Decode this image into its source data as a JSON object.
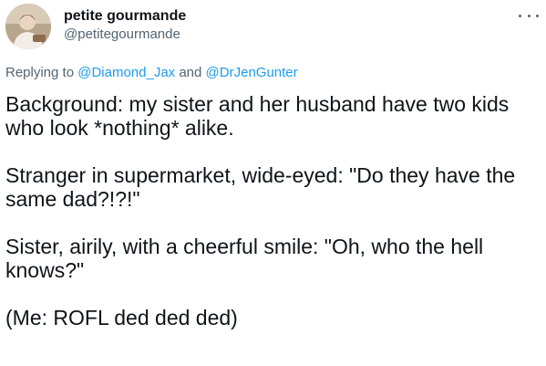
{
  "tweet": {
    "author": {
      "display_name": "petite gourmande",
      "handle": "@petitegourmande",
      "avatar": "avatar-photo"
    },
    "more_icon": "more-horizontal-icon",
    "reply": {
      "prefix": "Replying to",
      "mention_1": "@Diamond_Jax",
      "joiner": "and",
      "mention_2": "@DrJenGunter"
    },
    "paragraphs": [
      "Background: my sister and her husband have two kids who look *nothing* alike.",
      "Stranger in supermarket, wide-eyed: \"Do they have the same dad?!?!\"",
      "Sister, airily, with a cheerful smile: \"Oh, who the hell knows?\"",
      "(Me: ROFL ded ded ded)"
    ]
  },
  "colors": {
    "text_primary": "#0f1419",
    "text_secondary": "#536471",
    "link": "#1d9bf0",
    "background": "#ffffff"
  }
}
